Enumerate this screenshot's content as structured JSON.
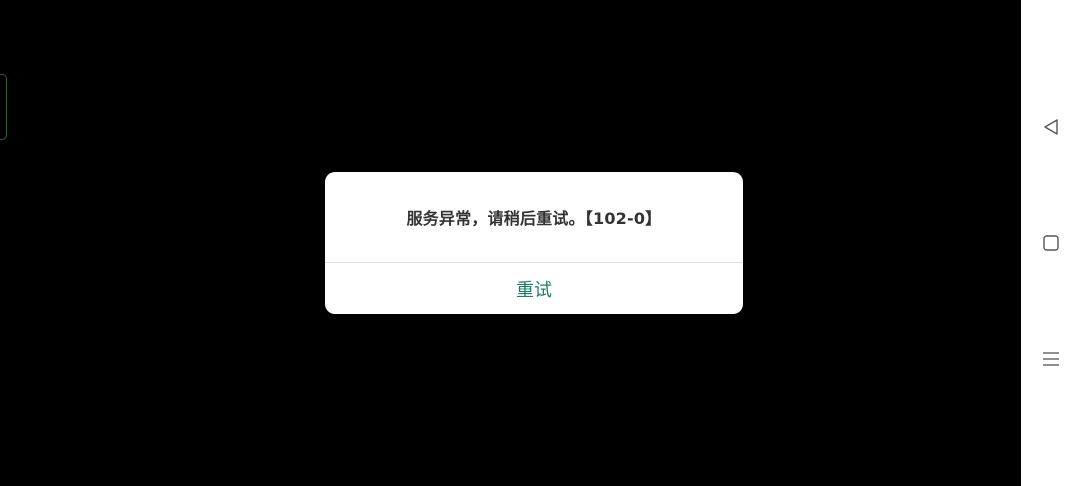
{
  "dialog": {
    "message": "服务异常，请稍后重试。【102-0】",
    "retry_label": "重试"
  },
  "navigation_bar": {
    "back_icon": "back-triangle-icon",
    "home_icon": "home-square-icon",
    "menu_icon": "menu-lines-icon"
  },
  "colors": {
    "background": "#000000",
    "dialog_background": "#ffffff",
    "message_text": "#333333",
    "accent_button": "#1e7c66",
    "nav_bar_background": "#ffffff",
    "nav_icon": "#555555"
  }
}
